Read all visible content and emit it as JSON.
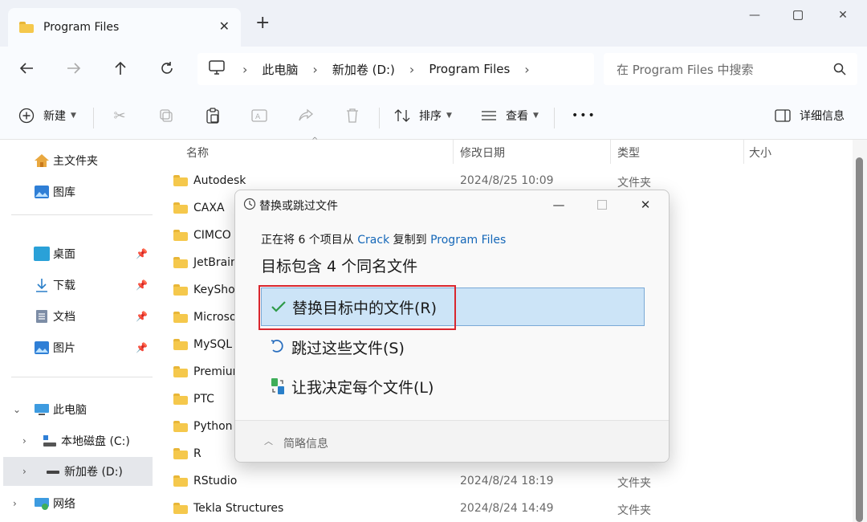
{
  "window": {
    "tab_title": "Program Files",
    "new_tab": "+",
    "close_tab": "✕"
  },
  "nav": {
    "breadcrumbs": [
      "此电脑",
      "新加卷 (D:)",
      "Program Files"
    ],
    "search_placeholder": "在 Program Files 中搜索"
  },
  "toolbar": {
    "new_label": "新建",
    "sort_label": "排序",
    "view_label": "查看",
    "more_label": "•••",
    "details_label": "详细信息"
  },
  "sidebar": {
    "quick": [
      {
        "label": "主文件夹",
        "icon": "home-icon"
      },
      {
        "label": "图库",
        "icon": "gallery-icon"
      }
    ],
    "pinned": [
      {
        "label": "桌面",
        "icon": "desktop-icon"
      },
      {
        "label": "下载",
        "icon": "download-icon"
      },
      {
        "label": "文档",
        "icon": "document-icon"
      },
      {
        "label": "图片",
        "icon": "pictures-icon"
      }
    ],
    "tree": [
      {
        "label": "此电脑",
        "icon": "computer-icon"
      },
      {
        "label": "本地磁盘 (C:)",
        "icon": "drive-icon"
      },
      {
        "label": "新加卷 (D:)",
        "icon": "drive-icon"
      },
      {
        "label": "网络",
        "icon": "network-icon"
      }
    ]
  },
  "columns": [
    "名称",
    "修改日期",
    "类型",
    "大小"
  ],
  "files": [
    {
      "name": "Autodesk",
      "date": "2024/8/25 10:09",
      "type": "文件夹"
    },
    {
      "name": "CAXA",
      "date": "",
      "type": ""
    },
    {
      "name": "CIMCO",
      "date": "",
      "type": ""
    },
    {
      "name": "JetBrain",
      "date": "",
      "type": ""
    },
    {
      "name": "KeySho",
      "date": "",
      "type": ""
    },
    {
      "name": "Microso",
      "date": "",
      "type": ""
    },
    {
      "name": "MySQL",
      "date": "",
      "type": ""
    },
    {
      "name": "Premium",
      "date": "",
      "type": ""
    },
    {
      "name": "PTC",
      "date": "",
      "type": ""
    },
    {
      "name": "Python",
      "date": "",
      "type": ""
    },
    {
      "name": "R",
      "date": "",
      "type": ""
    },
    {
      "name": "RStudio",
      "date": "2024/8/24 18:19",
      "type": "文件夹"
    },
    {
      "name": "Tekla Structures",
      "date": "2024/8/24 14:49",
      "type": "文件夹"
    }
  ],
  "dialog": {
    "title": "替换或跳过文件",
    "sub_prefix": "正在将 6 个项目从 ",
    "sub_source": "Crack",
    "sub_middle": " 复制到 ",
    "sub_dest": "Program Files",
    "heading": "目标包含 4 个同名文件",
    "options": [
      "替换目标中的文件(R)",
      "跳过这些文件(S)",
      "让我决定每个文件(L)"
    ],
    "footer": "简略信息"
  }
}
